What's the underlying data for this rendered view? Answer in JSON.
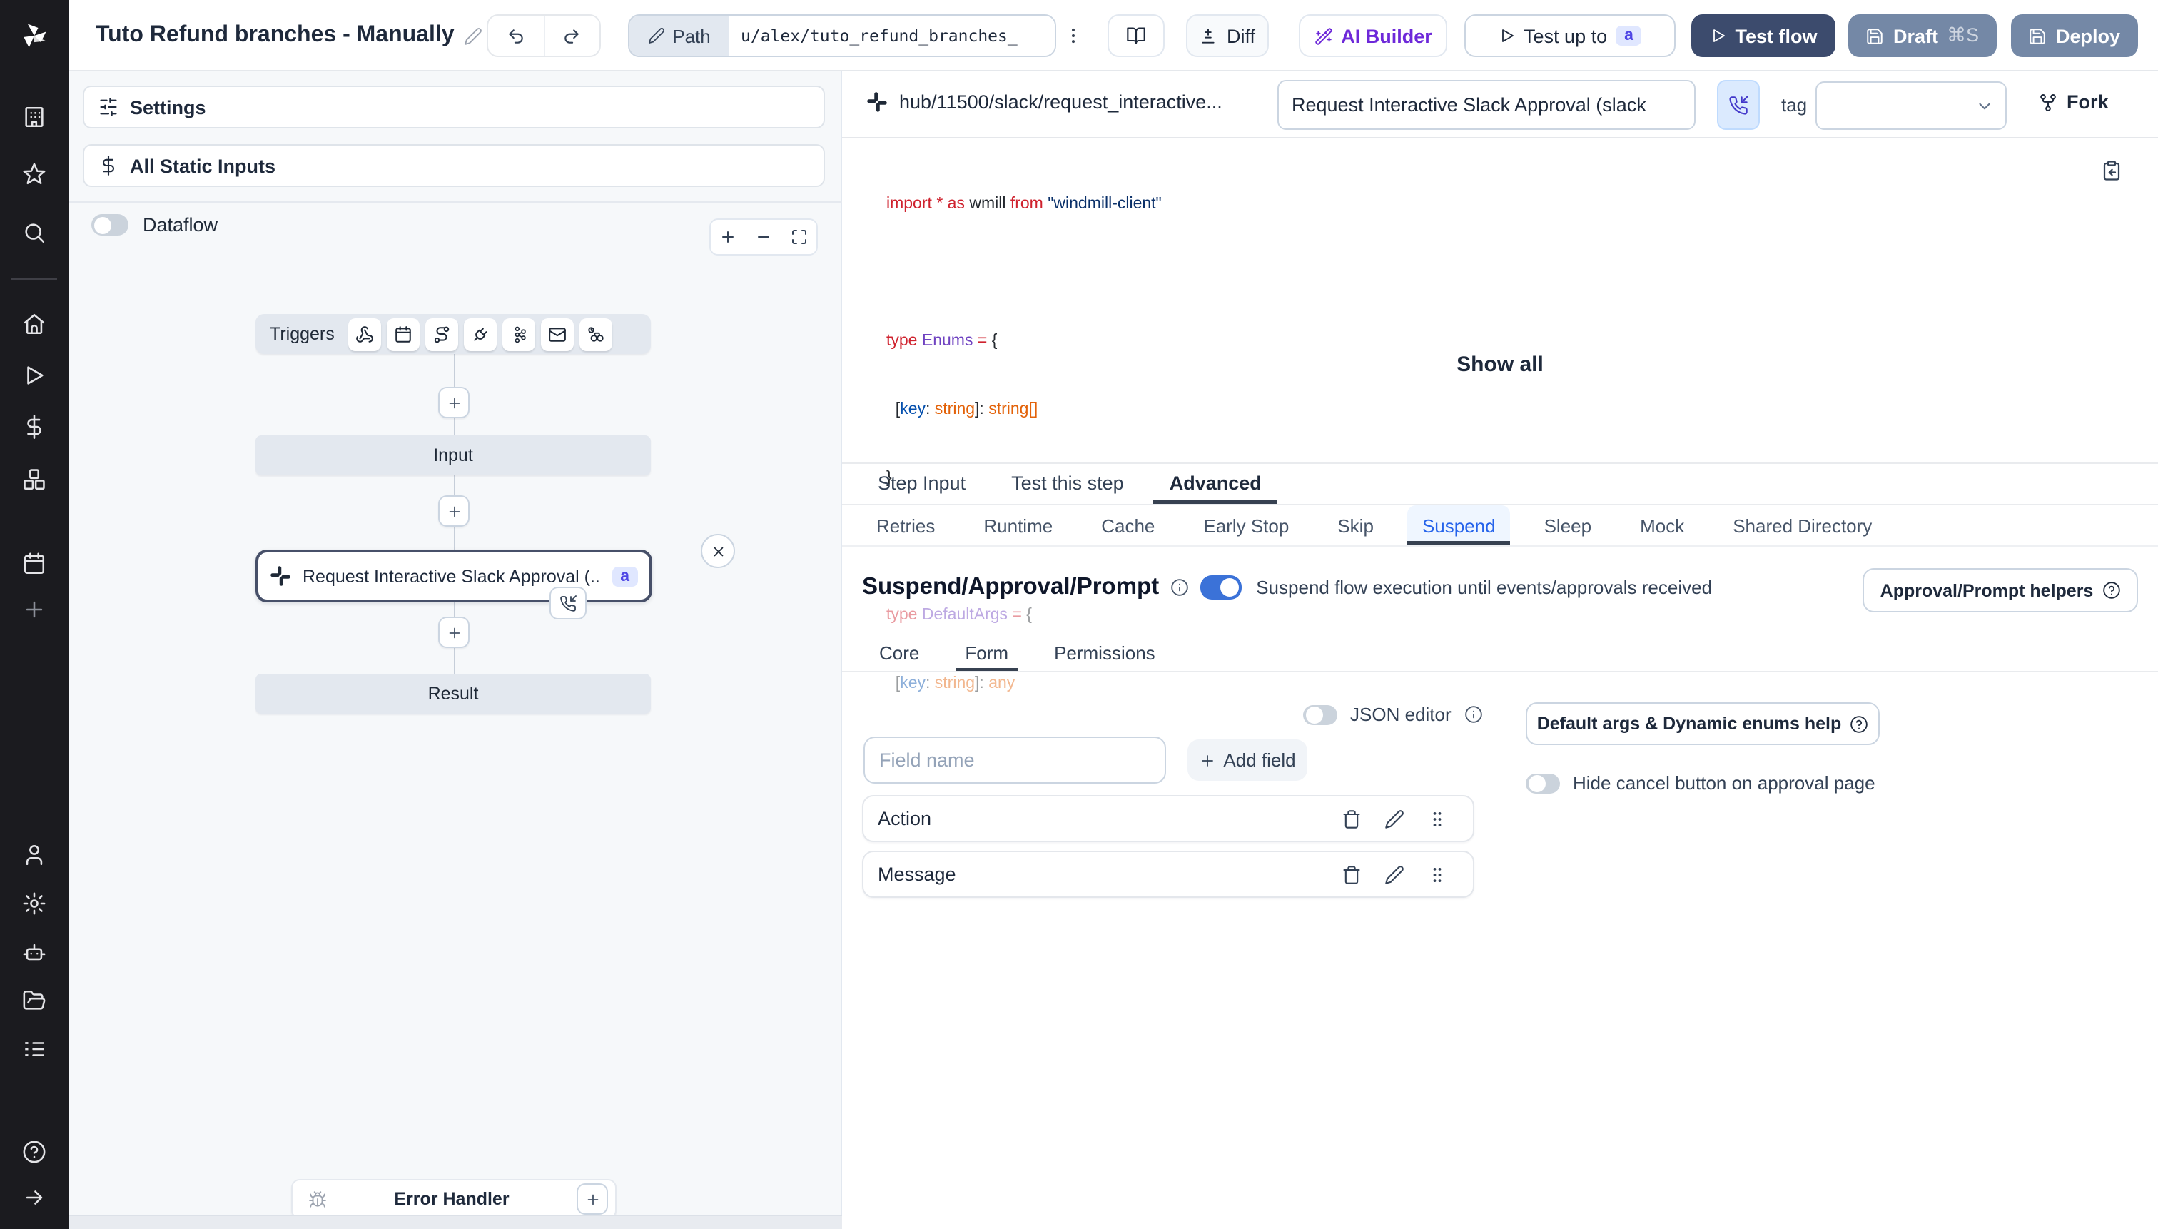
{
  "topbar": {
    "title": "Tuto Refund branches - Manually",
    "path_label": "Path",
    "path_value": "u/alex/tuto_refund_branches_",
    "diff": "Diff",
    "ai_builder": "AI Builder",
    "test_up_to": "Test up to",
    "test_up_to_badge": "a",
    "test_flow": "Test flow",
    "draft": "Draft",
    "draft_kbd": "⌘S",
    "deploy": "Deploy"
  },
  "left_panel": {
    "settings": "Settings",
    "all_static_inputs": "All Static Inputs",
    "dataflow": "Dataflow"
  },
  "graph": {
    "triggers_label": "Triggers",
    "input": "Input",
    "node_title": "Request Interactive Slack Approval (...",
    "node_badge": "a",
    "result": "Result",
    "error_handler": "Error Handler"
  },
  "editor": {
    "hub_path": "hub/11500/slack/request_interactive...",
    "name_value": "Request Interactive Slack Approval (slack",
    "tag_label": "tag",
    "fork": "Fork",
    "show_all": "Show all",
    "code": {
      "l1": {
        "a": "import ",
        "b": "* ",
        "c": "as ",
        "d": "wmill ",
        "e": "from ",
        "f": "\"windmill-client\""
      },
      "l2": {
        "a": "type ",
        "b": "Enums",
        "c": " = ",
        "d": "{"
      },
      "l3": {
        "a": "  [",
        "b": "key",
        "c": ": ",
        "d": "string",
        "e": "]: ",
        "f": "string[]"
      },
      "l4": "}",
      "l5": {
        "a": "type ",
        "b": "DefaultArgs",
        "c": " = ",
        "d": "{"
      },
      "l6": {
        "a": "  [",
        "b": "key",
        "c": ": ",
        "d": "string",
        "e": "]: ",
        "f": "any"
      },
      "l7": "}"
    }
  },
  "tabs": {
    "step_input": "Step Input",
    "test_this_step": "Test this step",
    "advanced": "Advanced"
  },
  "advanced_tabs": [
    "Retries",
    "Runtime",
    "Cache",
    "Early Stop",
    "Skip",
    "Suspend",
    "Sleep",
    "Mock",
    "Shared Directory"
  ],
  "suspend": {
    "title": "Suspend/Approval/Prompt",
    "toggle_text": "Suspend flow execution until events/approvals received",
    "helpers_button": "Approval/Prompt helpers",
    "core": "Core",
    "form": "Form",
    "permissions": "Permissions",
    "json_editor": "JSON editor",
    "field_placeholder": "Field name",
    "add_field": "Add field",
    "default_args_help": "Default args & Dynamic enums help",
    "hide_cancel": "Hide cancel button on approval page",
    "fields": [
      {
        "name": "Action"
      },
      {
        "name": "Message"
      }
    ]
  },
  "icons": {
    "rail": [
      "workspace",
      "favorites",
      "search",
      "home",
      "runs",
      "variables",
      "resources",
      "schedules",
      "add",
      "user",
      "settings",
      "workers",
      "folders",
      "logs",
      "help",
      "expand"
    ],
    "triggers": [
      "webhook",
      "schedule",
      "http-route",
      "websocket",
      "kafka",
      "email",
      "poll"
    ]
  }
}
